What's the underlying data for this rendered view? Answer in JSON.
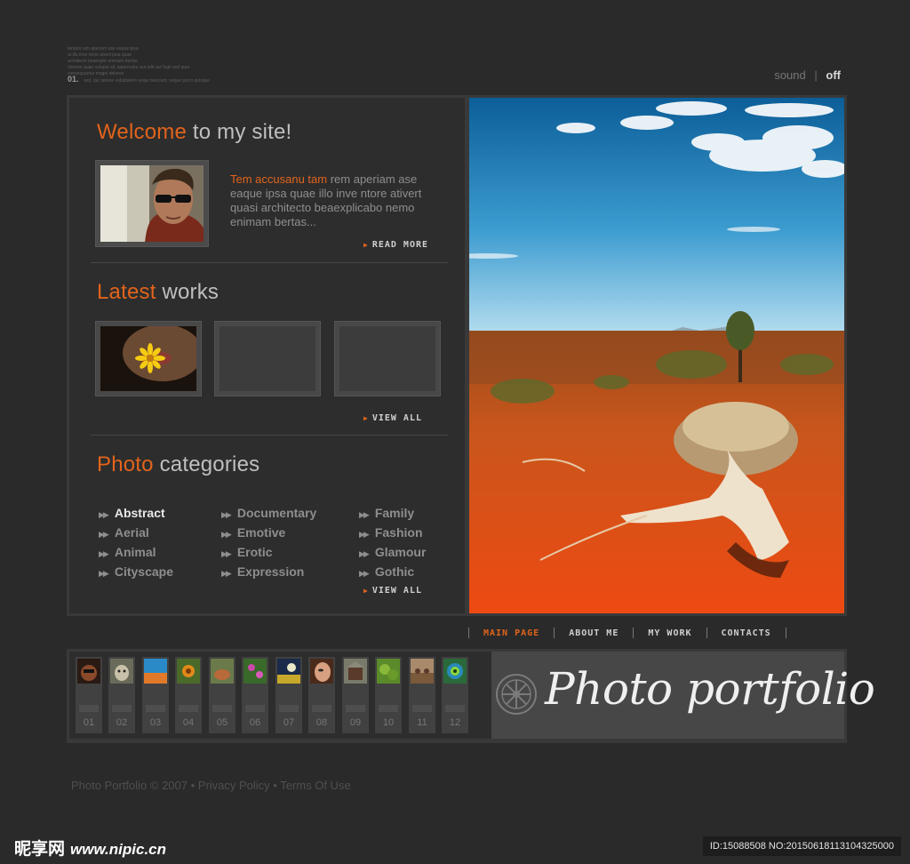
{
  "top": {
    "micro_lines": [
      "tempor sim aperiam ase eaque ipsa",
      "ut illu inve ntore atvert ipsa quae",
      "architecto beaexplic enimam bertas",
      "sherem quae volupta sit, aspernatur aut odit aut fugit sed quia",
      "consequuntur magni dolores"
    ],
    "index": "01.",
    "index_text": "sed, qui ratione voluptatem sequi nesciunt, neque porro quisque"
  },
  "sound": {
    "label": "sound",
    "separator": "|",
    "state": "off"
  },
  "welcome": {
    "title_accent": "Welcome",
    "title_rest": " to my site!",
    "text_accent": "Tem accusanu tam",
    "text_rest": " rem aperiam ase eaque ipsa quae illo inve ntore ativert quasi architecto beaexplicabo nemo enimam bertas...",
    "read_more": "READ MORE"
  },
  "latest": {
    "title_accent": "Latest",
    "title_rest": " works",
    "view_all": "VIEW ALL"
  },
  "categories": {
    "title_accent": "Photo",
    "title_rest": " categories",
    "col1": [
      "Abstract",
      "Aerial",
      "Animal",
      "Cityscape"
    ],
    "col2": [
      "Documentary",
      "Emotive",
      "Erotic",
      "Expression"
    ],
    "col3": [
      "Family",
      "Fashion",
      "Glamour",
      "Gothic"
    ],
    "active": "Abstract",
    "view_all": "VIEW ALL"
  },
  "nav": {
    "items": [
      "MAIN PAGE",
      "ABOUT ME",
      "MY WORK",
      "CONTACTS"
    ],
    "active": "MAIN PAGE"
  },
  "gallery": {
    "numbers": [
      "01",
      "02",
      "03",
      "04",
      "05",
      "06",
      "07",
      "08",
      "09",
      "10",
      "11",
      "12"
    ]
  },
  "brand": {
    "title": "Photo portfolio"
  },
  "footer": {
    "copyright": "Photo Portfolio © 2007 • Privacy Policy • Terms Of Use"
  },
  "watermark": {
    "site_cn": "昵享网",
    "url": "www.nipic.cn",
    "id_text": "ID:15088508 NO:20150618113104325000"
  },
  "colors": {
    "accent": "#e1641c",
    "background": "#2a2a2a",
    "panel": "#2d2d2d"
  }
}
